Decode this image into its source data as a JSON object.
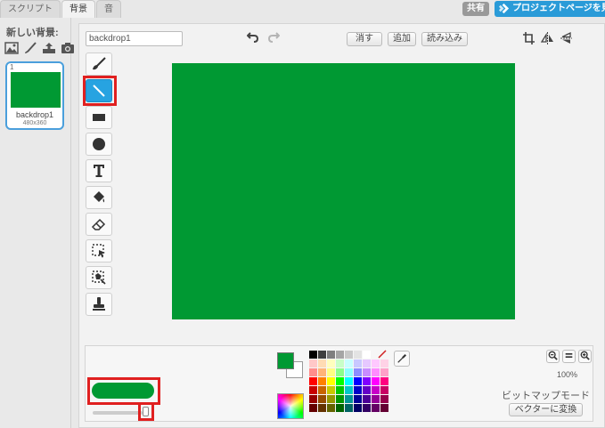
{
  "tabs": [
    {
      "label": "スクリプト"
    },
    {
      "label": "背景"
    },
    {
      "label": "音"
    }
  ],
  "header": {
    "share_label": "共有",
    "project_page_label": "プロジェクトページを見る"
  },
  "sidebar": {
    "new_backdrop_label": "新しい背景:",
    "new_icons": [
      "image-library-icon",
      "paint-brush-icon",
      "upload-icon",
      "camera-icon"
    ],
    "backdrops": [
      {
        "number": "1",
        "name": "backdrop1",
        "size": "480x360",
        "color": "#009933"
      }
    ]
  },
  "editor": {
    "costume_name": "backdrop1",
    "clear_label": "消す",
    "add_label": "追加",
    "import_label": "読み込み",
    "tools": [
      "brush-icon",
      "line-icon",
      "rectangle-icon",
      "ellipse-icon",
      "text-icon",
      "fill-icon",
      "eraser-icon",
      "select-icon",
      "remove-background-icon",
      "stamp-icon"
    ],
    "selected_tool": "line-icon",
    "canvas_color": "#009933",
    "line_width_value": "0",
    "zoom": "100%",
    "mode_label": "ビットマップモード",
    "convert_label": "ベクターに変換"
  },
  "colors": {
    "foreground": "#009933",
    "background": "#ffffff",
    "palette": [
      "#000000",
      "#3f3f3f",
      "#7f7f7f",
      "#a5a5a5",
      "#c8c8c8",
      "#e3e3e3",
      "#ffffff",
      "#ffffff",
      "#ffffff",
      "#ffc8c8",
      "#ffdcb4",
      "#ffffbe",
      "#c8ffc8",
      "#c8ffff",
      "#c8c8ff",
      "#e6c8ff",
      "#ffc8ff",
      "#ffd2e6",
      "#ff8c8c",
      "#ffb478",
      "#ffff82",
      "#8cff8c",
      "#8cffff",
      "#8c8cff",
      "#c88cff",
      "#ff8cff",
      "#ffa0c8",
      "#ff0000",
      "#ff8000",
      "#ffff00",
      "#00ff00",
      "#00ffff",
      "#0000ff",
      "#8000ff",
      "#ff00ff",
      "#ff0080",
      "#c80000",
      "#c86400",
      "#c8c800",
      "#00c800",
      "#00c8c8",
      "#0000c8",
      "#6400c8",
      "#c800c8",
      "#c80064",
      "#960000",
      "#964b00",
      "#969600",
      "#009600",
      "#009696",
      "#000096",
      "#4b0096",
      "#960096",
      "#96004b",
      "#640000",
      "#643200",
      "#646400",
      "#006400",
      "#006464",
      "#000064",
      "#320064",
      "#640064",
      "#640032"
    ]
  }
}
